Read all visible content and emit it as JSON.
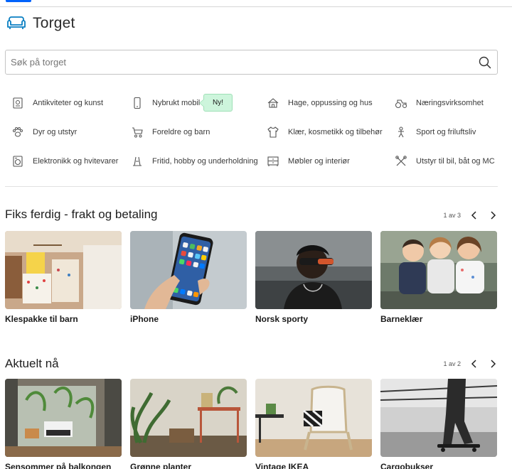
{
  "header": {
    "title": "Torget"
  },
  "search": {
    "placeholder": "Søk på torget"
  },
  "categories": [
    {
      "label": "Antikviteter og kunst",
      "icon": "antique-icon"
    },
    {
      "label": "Nybrukt mobil",
      "icon": "mobile-icon"
    },
    {
      "label": "Hage, oppussing og hus",
      "icon": "house-icon"
    },
    {
      "label": "Næringsvirksomhet",
      "icon": "tractor-icon"
    },
    {
      "label": "Dyr og utstyr",
      "icon": "paw-icon"
    },
    {
      "label": "Foreldre og barn",
      "icon": "stroller-icon"
    },
    {
      "label": "Klær, kosmetikk og tilbehør",
      "icon": "shirt-icon"
    },
    {
      "label": "Sport og friluftsliv",
      "icon": "bicycle-icon"
    },
    {
      "label": "Elektronikk og hvitevarer",
      "icon": "washing-machine-icon"
    },
    {
      "label": "Fritid, hobby og underholdning",
      "icon": "hobby-icon"
    },
    {
      "label": "Møbler og interiør",
      "icon": "dresser-icon"
    },
    {
      "label": "Utstyr til bil, båt og MC",
      "icon": "tools-icon"
    }
  ],
  "new_badge": "Ny!",
  "sections": [
    {
      "title": "Fiks ferdig - frakt og betaling",
      "pager": "1 av 3",
      "cards": [
        {
          "label": "Klespakke til barn"
        },
        {
          "label": "iPhone"
        },
        {
          "label": "Norsk sporty"
        },
        {
          "label": "Barneklær"
        }
      ]
    },
    {
      "title": "Aktuelt nå",
      "pager": "1 av 2",
      "cards": [
        {
          "label": "Sensommer på balkongen"
        },
        {
          "label": "Grønne planter"
        },
        {
          "label": "Vintage IKEA"
        },
        {
          "label": "Cargobukser"
        }
      ]
    }
  ],
  "colors": {
    "accent": "#0063fb",
    "badge_bg": "#cdf5dc",
    "border": "#c4c4c4"
  }
}
